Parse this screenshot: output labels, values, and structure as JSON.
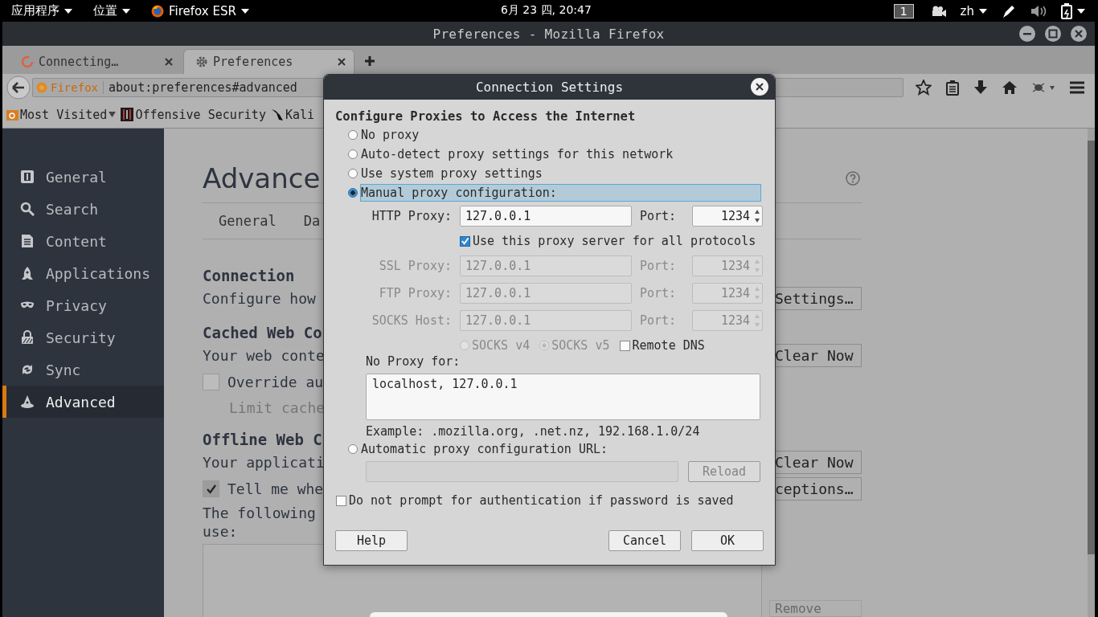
{
  "top_bar": {
    "menus": [
      {
        "label": "应用程序",
        "kind": "apps"
      },
      {
        "label": "位置",
        "kind": "places"
      },
      {
        "label": "Firefox ESR",
        "kind": "app"
      }
    ],
    "clock": "6月 23 四, 20:47",
    "workspace": "1",
    "language": "zh"
  },
  "window": {
    "title": "Preferences - Mozilla Firefox"
  },
  "tabs": [
    {
      "label": "Connecting…",
      "selected": false,
      "kind": "loading"
    },
    {
      "label": "Preferences",
      "selected": true,
      "kind": "settings"
    }
  ],
  "address_bar": {
    "identity": "Firefox",
    "value": "about:preferences#advanced"
  },
  "bookmarks": [
    {
      "label": "Most Visited",
      "kind": "folder"
    },
    {
      "label": "Offensive Security",
      "kind": "site"
    },
    {
      "label": "Kali",
      "kind": "tool"
    }
  ],
  "sidebar": {
    "items": [
      {
        "label": "General",
        "selected": false
      },
      {
        "label": "Search",
        "selected": false
      },
      {
        "label": "Content",
        "selected": false
      },
      {
        "label": "Applications",
        "selected": false
      },
      {
        "label": "Privacy",
        "selected": false
      },
      {
        "label": "Security",
        "selected": false
      },
      {
        "label": "Sync",
        "selected": false
      },
      {
        "label": "Advanced",
        "selected": true
      }
    ]
  },
  "preferences": {
    "heading": "Advance",
    "subtabs": [
      {
        "label": "General"
      },
      {
        "label": "Da"
      }
    ],
    "rows": [
      {
        "kind": "heading",
        "text": "Connection"
      },
      {
        "kind": "text",
        "text": "Configure how",
        "button": "Settings…"
      },
      {
        "kind": "heading",
        "text": "Cached Web Co"
      },
      {
        "kind": "text",
        "text": "Your web conte",
        "button": "Clear Now"
      },
      {
        "kind": "checkbox",
        "text": "Override au",
        "checked": false
      },
      {
        "kind": "sub",
        "text": "Limit cache",
        "disabled": true
      },
      {
        "kind": "heading",
        "text": "Offline Web C"
      },
      {
        "kind": "text",
        "text": "Your applicati",
        "button": "Clear Now"
      },
      {
        "kind": "checkbox",
        "text": "Tell me whe",
        "checked": true,
        "button": "ceptions…"
      },
      {
        "kind": "para",
        "text": "The following\nuse:"
      }
    ],
    "list_button": {
      "label": "Remove",
      "disabled": true
    }
  },
  "dialog": {
    "title": "Connection Settings",
    "heading": "Configure Proxies to Access the Internet",
    "modes": [
      {
        "label": "No proxy",
        "selected": false
      },
      {
        "label": "Auto-detect proxy settings for this network",
        "selected": false
      },
      {
        "label": "Use system proxy settings",
        "selected": false
      },
      {
        "label": "Manual proxy configuration:",
        "selected": true
      }
    ],
    "proxies": [
      {
        "label": "HTTP Proxy:",
        "host": "127.0.0.1",
        "port_label": "Port:",
        "port": "1234",
        "disabled": false
      },
      {
        "label": "SSL Proxy:",
        "host": "127.0.0.1",
        "port_label": "Port:",
        "port": "1234",
        "disabled": true
      },
      {
        "label": "FTP Proxy:",
        "host": "127.0.0.1",
        "port_label": "Port:",
        "port": "1234",
        "disabled": true
      }
    ],
    "share_all": {
      "label": "Use this proxy server for all protocols",
      "checked": true
    },
    "socks": {
      "label": "SOCKS Host:",
      "host": "127.0.0.1",
      "port_label": "Port:",
      "port": "1234",
      "disabled": true
    },
    "socks_versions": [
      {
        "label": "SOCKS v4",
        "selected": false,
        "disabled": true
      },
      {
        "label": "SOCKS v5",
        "selected": true,
        "disabled": true
      }
    ],
    "remote_dns": {
      "label": "Remote DNS",
      "checked": false
    },
    "no_proxy_label": "No Proxy for:",
    "no_proxy_value": "localhost, 127.0.0.1",
    "example": "Example: .mozilla.org, .net.nz, 192.168.1.0/24",
    "auto_config": {
      "label": "Automatic proxy configuration URL:",
      "selected": false,
      "disabled": true,
      "reload": "Reload"
    },
    "no_prompt": {
      "label": "Do not prompt for authentication if password is saved",
      "checked": false
    },
    "buttons": [
      {
        "label": "Help",
        "kind": "left"
      },
      {
        "label": "Cancel",
        "kind": "right"
      },
      {
        "label": "OK",
        "kind": "right"
      }
    ]
  }
}
